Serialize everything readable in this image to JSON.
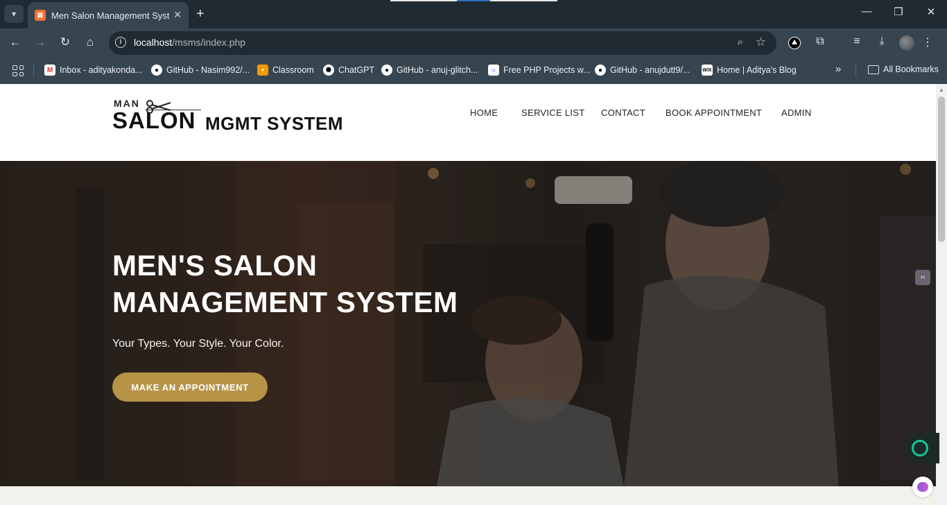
{
  "browser": {
    "tab_title": "Men Salon Management System",
    "url_host": "localhost",
    "url_path": "/msms/index.php",
    "bookmarks": [
      {
        "label": "Inbox - adityakonda...",
        "icon": "gmail-icon"
      },
      {
        "label": "GitHub - Nasim992/...",
        "icon": "github-icon"
      },
      {
        "label": "Classroom",
        "icon": "classroom-icon"
      },
      {
        "label": "ChatGPT",
        "icon": "chatgpt-icon"
      },
      {
        "label": "GitHub - anuj-glitch...",
        "icon": "github-icon"
      },
      {
        "label": "Free PHP Projects w...",
        "icon": "php-icon"
      },
      {
        "label": "GitHub - anujdutt9/...",
        "icon": "github-icon"
      },
      {
        "label": "Home | Aditya's Blog",
        "icon": "wix-icon"
      }
    ],
    "all_bookmarks": "All Bookmarks"
  },
  "site": {
    "logo_man": "MAN",
    "logo_salon": "SALON",
    "logo_mgmt": "MGMT SYSTEM",
    "nav": [
      "HOME",
      "SERVICE LIST",
      "CONTACT",
      "BOOK APPOINTMENT",
      "ADMIN"
    ]
  },
  "hero": {
    "title_line1": "MEN'S SALON",
    "title_line2": "MANAGEMENT SYSTEM",
    "subtitle": "Your Types. Your Style. Your Color.",
    "button": "MAKE AN APPOINTMENT"
  },
  "colors": {
    "accent": "#b69347",
    "chrome_dark": "#1f2a33",
    "chrome": "#374550"
  }
}
